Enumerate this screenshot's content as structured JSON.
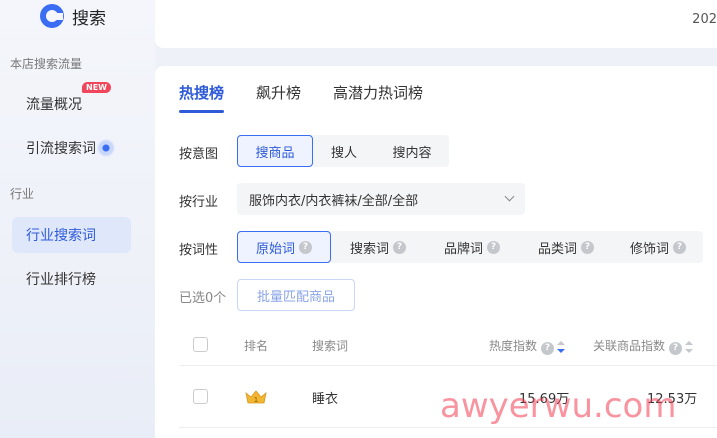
{
  "sidebar": {
    "title": "搜索",
    "group_store": "本店搜索流量",
    "item_overview": "流量概况",
    "badge_new": "NEW",
    "item_keywords": "引流搜索词",
    "group_industry": "行业",
    "item_industry_keywords": "行业搜索词",
    "item_industry_rank": "行业排行榜"
  },
  "header": {
    "date_partial": "202"
  },
  "tabs": [
    "热搜榜",
    "飙升榜",
    "高潜力热词榜"
  ],
  "filters": {
    "intent_label": "按意图",
    "intent_options": [
      "搜商品",
      "搜人",
      "搜内容"
    ],
    "industry_label": "按行业",
    "industry_value": "服饰内衣/内衣裤袜/全部/全部",
    "wordtype_label": "按词性",
    "wordtype_options": [
      "原始词",
      "搜索词",
      "品牌词",
      "品类词",
      "修饰词"
    ]
  },
  "actions": {
    "selected_count": "已选0个",
    "batch_match": "批量匹配商品"
  },
  "table": {
    "headers": {
      "rank": "排名",
      "keyword": "搜索词",
      "heat": "热度指数",
      "related": "关联商品指数"
    },
    "rows": [
      {
        "keyword": "睡衣",
        "heat": "15.69万",
        "related": "12.53万"
      }
    ]
  },
  "watermark": "awyerwu.com",
  "colors": {
    "accent": "#2f5bd9",
    "badge": "#f0455a"
  }
}
